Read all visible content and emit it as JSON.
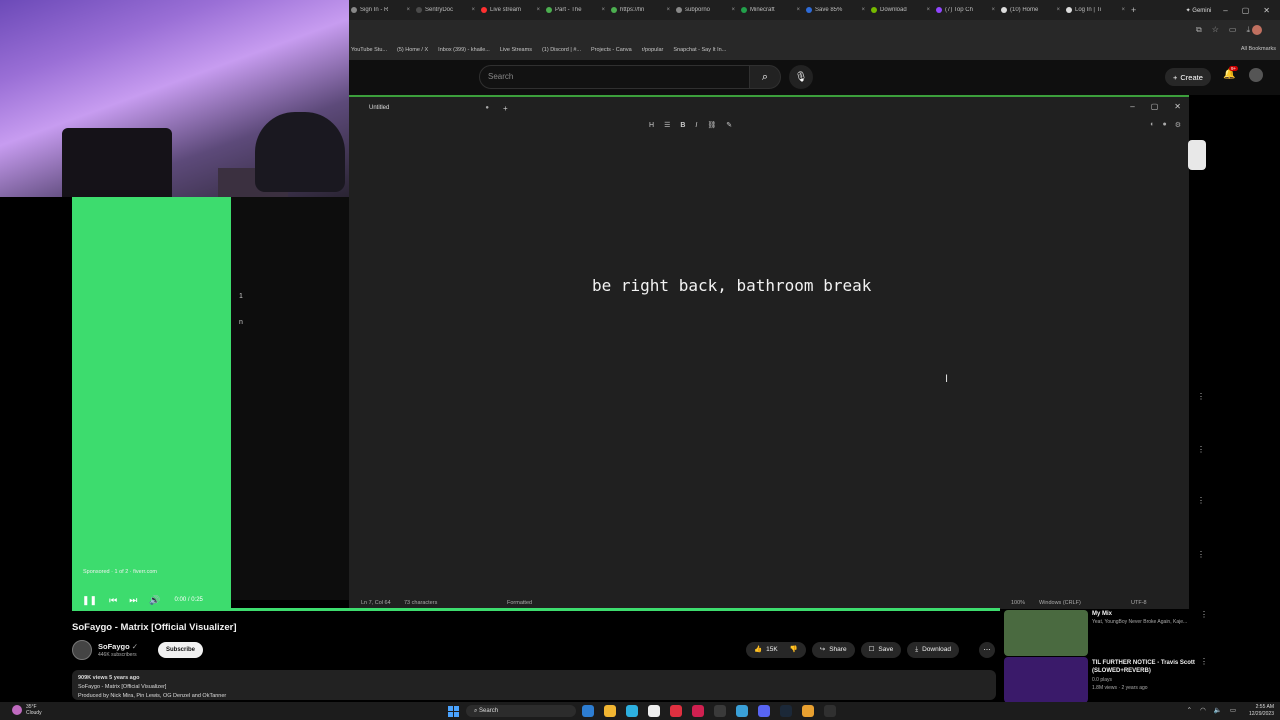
{
  "browser": {
    "tabs": [
      "Sign In - R",
      "SentryDoc",
      "Live stream",
      "Part - The",
      "https://fin",
      "subporno",
      "Minecraft",
      "Save 85%",
      "Download",
      "(7) Top Ch",
      "(10) Home",
      "Log In | Ti"
    ],
    "tab_colors": [
      "#888888",
      "#4a4a4a",
      "#ff3030",
      "#4caf50",
      "#4caf50",
      "#888888",
      "#22a04b",
      "#2e6bd8",
      "#76b900",
      "#9146ff",
      "#dddddd",
      "#dddddd"
    ],
    "new_tab_label": "+",
    "gemini_label": "✦ Gemini",
    "bookmarks": [
      "YouTube Stu...",
      "(5) Home / X",
      "Inbox (399) - khaile...",
      "Live Streams",
      "(1) Discord | #...",
      "Projects - Canva",
      "r/popular",
      "Snapchat - Say It In..."
    ],
    "all_bookmarks": "All Bookmarks"
  },
  "youtube": {
    "search_placeholder": "Search",
    "create_label": "Create",
    "notification_count": "9+"
  },
  "notepad": {
    "tab_title": "Untitled",
    "new_tab": "+",
    "toolbar": {
      "heading": "H",
      "list": "☰",
      "bold": "B",
      "italic": "I",
      "link": "⛓",
      "clear": "✎"
    },
    "content": "be right back, bathroom break",
    "status": {
      "position": "Ln 7, Col 64",
      "chars": "73 characters",
      "format": "Formatted",
      "zoom": "100%",
      "line_ending": "Windows (CRLF)",
      "encoding": "UTF-8"
    }
  },
  "side_numbers": [
    "1",
    "n"
  ],
  "player": {
    "sponsored": "Sponsored · 1 of 2 · fiverr.com",
    "time": "0:00 / 0:25"
  },
  "video": {
    "title": "SoFaygo - Matrix [Official Visualizer]",
    "channel": "SoFaygo",
    "subscribers": "446K subscribers",
    "subscribe_label": "Subscribe",
    "likes": "15K",
    "share_label": "Share",
    "save_label": "Save",
    "download_label": "Download",
    "desc_line1": "909K views  5 years ago",
    "desc_line2": "SoFaygo - Matrix [Official Visualizer]",
    "desc_line3": "Produced by Nick Mira, Pin Lewis, OG Denzel and OkTanner"
  },
  "recommendations": [
    {
      "title": "My Mix",
      "meta1": "Yeat, YoungBoy Never Broke Again, Kaje...",
      "meta2": "",
      "thumb_color": "#4a6a40"
    },
    {
      "title": "TIL FURTHER NOTICE - Travis Scott (SLOWED+REVERB)",
      "meta1": "0.0 plays",
      "meta2": "1.8M views · 2 years ago",
      "thumb_color": "#3a1a6a"
    }
  ],
  "taskbar": {
    "weather_temp": "35°F",
    "weather_desc": "Cloudy",
    "search_label": "Search",
    "time": "2:55 AM",
    "date": "12/29/2023"
  }
}
